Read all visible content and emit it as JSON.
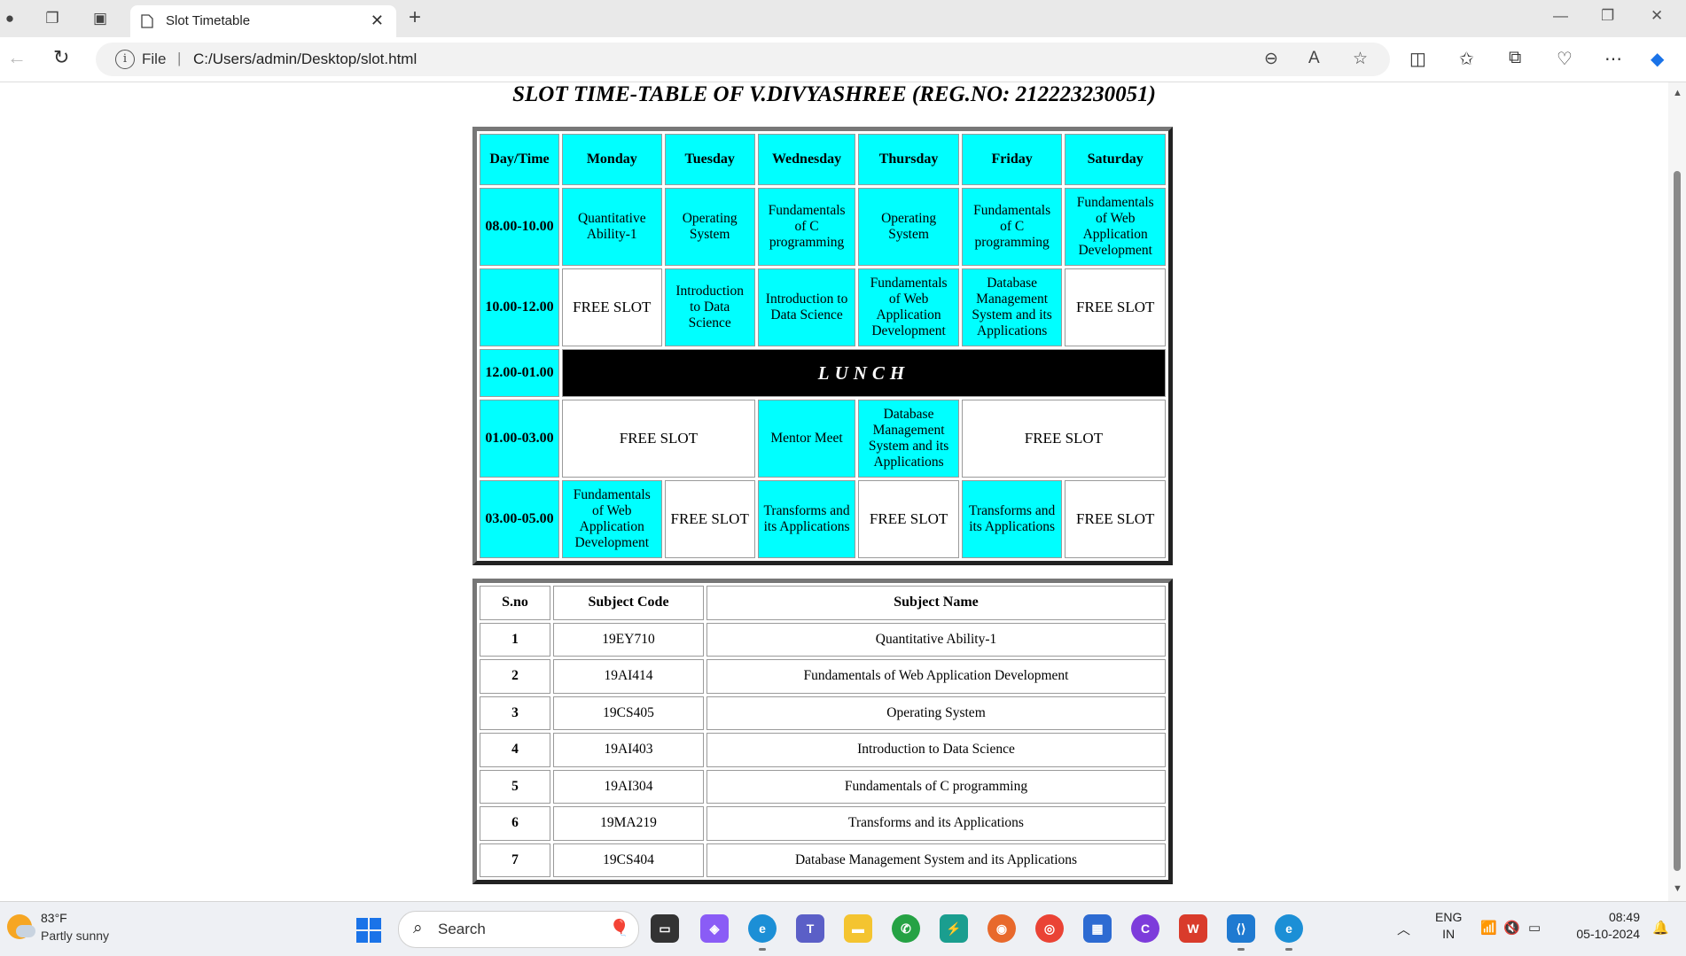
{
  "browser": {
    "tab_title": "Slot Timetable",
    "address_file_label": "File",
    "address_separator": "|",
    "url": "C:/Users/admin/Desktop/slot.html"
  },
  "page": {
    "title": "SLOT TIME-TABLE OF V.DIVYASHREE (REG.NO: 212223230051)"
  },
  "timetable": {
    "headers": [
      "Day/Time",
      "Monday",
      "Tuesday",
      "Wednesday",
      "Thursday",
      "Friday",
      "Saturday"
    ],
    "row1": {
      "time": "08.00-10.00",
      "monday": "Quantitative Ability-1",
      "tuesday": "Operating System",
      "wednesday": "Fundamentals of C programming",
      "thursday": "Operating System",
      "friday": "Fundamentals of C programming",
      "saturday": "Fundamentals of Web Application Development"
    },
    "row2": {
      "time": "10.00-12.00",
      "monday": "FREE SLOT",
      "tuesday": "Introduction to Data Science",
      "wednesday": "Introduction to Data Science",
      "thursday": "Fundamentals of Web Application Development",
      "friday": "Database Management System and its Applications",
      "saturday": "FREE SLOT"
    },
    "row3": {
      "time": "12.00-01.00",
      "lunch": "LUNCH"
    },
    "row4": {
      "time": "01.00-03.00",
      "mon_tue": "FREE SLOT",
      "wednesday": "Mentor Meet",
      "thursday": "Database Management System and its Applications",
      "fri_sat": "FREE SLOT"
    },
    "row5": {
      "time": "03.00-05.00",
      "monday": "Fundamentals of Web Application Development",
      "tuesday": "FREE SLOT",
      "wednesday": "Transforms and its Applications",
      "thursday": "FREE SLOT",
      "friday": "Transforms and its Applications",
      "saturday": "FREE SLOT"
    }
  },
  "subjects": {
    "headers": [
      "S.no",
      "Subject Code",
      "Subject Name"
    ],
    "rows": [
      {
        "sno": "1",
        "code": "19EY710",
        "name": "Quantitative Ability-1"
      },
      {
        "sno": "2",
        "code": "19AI414",
        "name": "Fundamentals of Web Application Development"
      },
      {
        "sno": "3",
        "code": "19CS405",
        "name": "Operating System"
      },
      {
        "sno": "4",
        "code": "19AI403",
        "name": "Introduction to Data Science"
      },
      {
        "sno": "5",
        "code": "19AI304",
        "name": "Fundamentals of C programming"
      },
      {
        "sno": "6",
        "code": "19MA219",
        "name": "Transforms and its Applications"
      },
      {
        "sno": "7",
        "code": "19CS404",
        "name": "Database Management System and its Applications"
      }
    ]
  },
  "taskbar": {
    "temperature": "83°F",
    "weather": "Partly sunny",
    "search_placeholder": "Search",
    "lang_line1": "ENG",
    "lang_line2": "IN",
    "time": "08:49",
    "date": "05-10-2024"
  },
  "colors": {
    "cell_cyan": "#00ffff",
    "lunch_bg": "#000000",
    "windows_blue": "#1a73e8"
  }
}
